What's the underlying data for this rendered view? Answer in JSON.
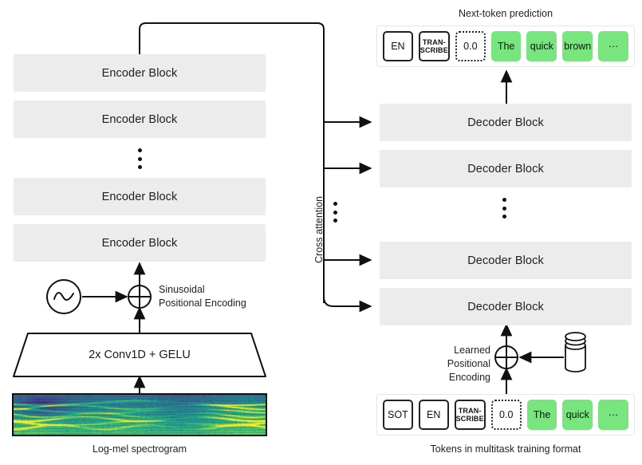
{
  "encoder": {
    "block_label": "Encoder Block",
    "count_shown": 4,
    "ellipsis": "vertical-dots",
    "frontend_label": "2x Conv1D + GELU",
    "positional_label_line1": "Sinusoidal",
    "positional_label_line2": "Positional Encoding",
    "input_caption": "Log-mel spectrogram",
    "sine_icon": "sine-wave-icon",
    "sum_icon": "circled-plus-icon"
  },
  "cross_attention": {
    "label": "Cross attention",
    "ellipsis": "vertical-dots"
  },
  "decoder": {
    "block_label": "Decoder Block",
    "count_shown": 4,
    "ellipsis": "vertical-dots",
    "positional_label_line1": "Learned",
    "positional_label_line2": "Positional Encoding",
    "embedding_icon": "database-cylinder-icon",
    "sum_icon": "circled-plus-icon"
  },
  "output": {
    "title": "Next-token prediction",
    "tokens": [
      {
        "text": "EN",
        "style": "solid",
        "multiline": false
      },
      {
        "text": "TRAN-SCRIBE",
        "style": "solid",
        "multiline": true
      },
      {
        "text": "0.0",
        "style": "dashed",
        "multiline": false
      },
      {
        "text": "The",
        "style": "green",
        "multiline": false
      },
      {
        "text": "quick",
        "style": "green",
        "multiline": false
      },
      {
        "text": "brown",
        "style": "green",
        "multiline": false
      },
      {
        "text": "···",
        "style": "green",
        "multiline": false
      }
    ]
  },
  "input_tokens": {
    "caption": "Tokens in multitask training format",
    "tokens": [
      {
        "text": "SOT",
        "style": "solid",
        "multiline": false
      },
      {
        "text": "EN",
        "style": "solid",
        "multiline": false
      },
      {
        "text": "TRAN-SCRIBE",
        "style": "solid",
        "multiline": true
      },
      {
        "text": "0.0",
        "style": "dashed",
        "multiline": false
      },
      {
        "text": "The",
        "style": "green",
        "multiline": false
      },
      {
        "text": "quick",
        "style": "green",
        "multiline": false
      },
      {
        "text": "···",
        "style": "green",
        "multiline": false
      }
    ]
  },
  "colors": {
    "block_fill": "#ececec",
    "token_green": "#78e57f",
    "stroke": "#111111",
    "container_border": "#e6e6e6",
    "page_background": "#ffffff"
  }
}
